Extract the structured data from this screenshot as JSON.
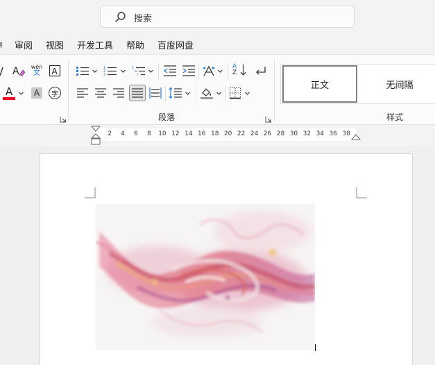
{
  "search": {
    "placeholder": "搜索"
  },
  "menu": {
    "items": [
      {
        "label": "审阅"
      },
      {
        "label": "视图"
      },
      {
        "label": "开发工具"
      },
      {
        "label": "帮助"
      },
      {
        "label": "百度网盘"
      }
    ]
  },
  "ribbon": {
    "paragraph_group_label": "段落",
    "styles_group_label": "样式",
    "pinyin_top": "wén",
    "pinyin_bottom": "文",
    "font_color_letter": "A",
    "shade_letter": "A",
    "enclose_char": "字",
    "sort_letters_top": "A",
    "sort_letters_bottom": "Z",
    "font_color_hex": "#e81123",
    "styles": [
      {
        "label": "正文"
      },
      {
        "label": "无间隔"
      }
    ]
  },
  "ruler": {
    "numbers": [
      "2",
      "4",
      "6",
      "8",
      "10",
      "12",
      "14",
      "16",
      "18",
      "20",
      "22",
      "24",
      "26",
      "28",
      "30",
      "32",
      "34",
      "36",
      "38"
    ]
  }
}
